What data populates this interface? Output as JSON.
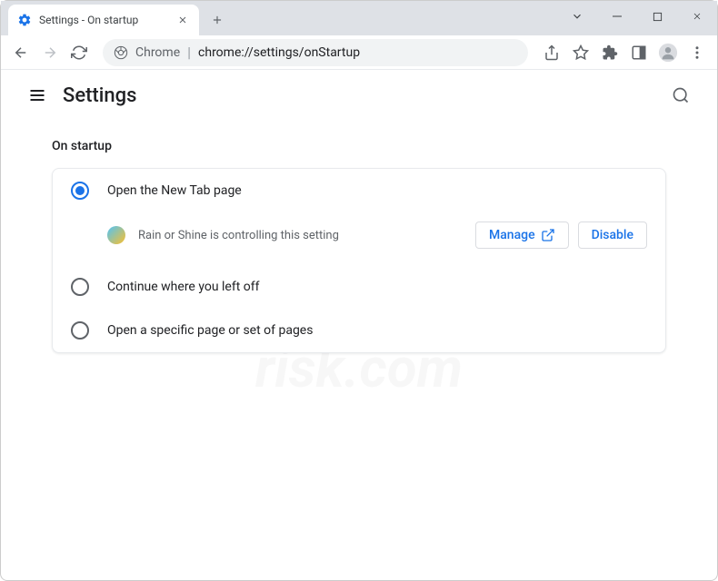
{
  "tab": {
    "title": "Settings - On startup"
  },
  "omnibox": {
    "prefix": "Chrome",
    "url": "chrome://settings/onStartup"
  },
  "header": {
    "title": "Settings"
  },
  "section": {
    "title": "On startup"
  },
  "options": [
    {
      "label": "Open the New Tab page",
      "selected": true
    },
    {
      "label": "Continue where you left off",
      "selected": false
    },
    {
      "label": "Open a specific page or set of pages",
      "selected": false
    }
  ],
  "extension": {
    "notice": "Rain or Shine is controlling this setting",
    "manage": "Manage",
    "disable": "Disable"
  }
}
